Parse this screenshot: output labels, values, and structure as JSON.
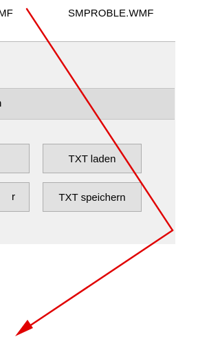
{
  "files": {
    "left_label": "MF",
    "right_label": "SMPROBLE.WMF"
  },
  "panel": {
    "header_text": "n",
    "buttons": {
      "left_top_label": "",
      "left_bottom_label": "r",
      "txt_laden_label": "TXT laden",
      "txt_speichern_label": "TXT speichern"
    }
  },
  "annotation": {
    "arrow_color": "#e00000"
  }
}
